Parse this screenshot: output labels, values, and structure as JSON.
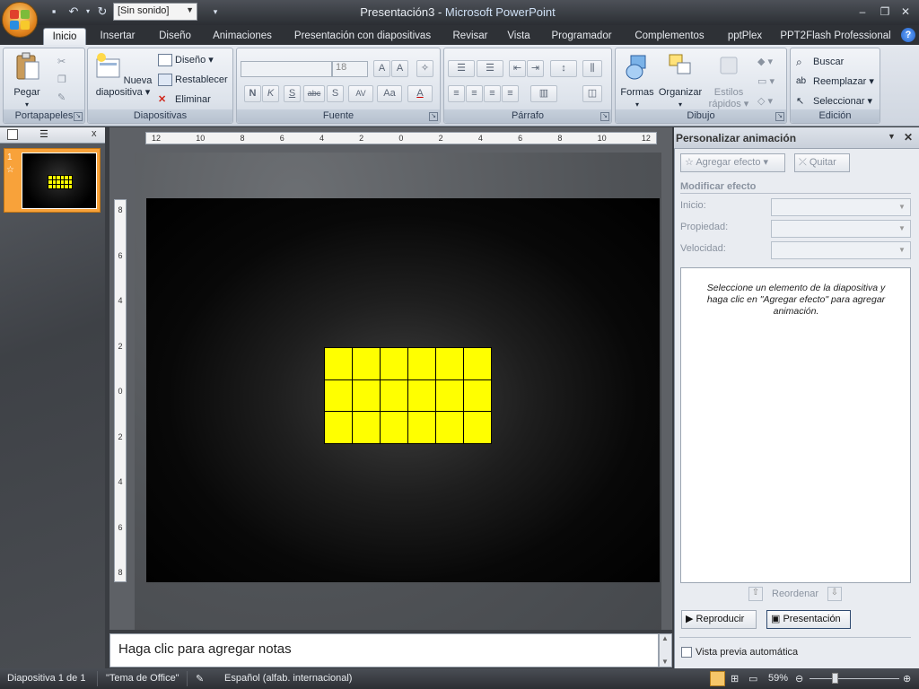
{
  "app": {
    "title": "Presentación3",
    "app_name": "Microsoft PowerPoint",
    "separator": " - "
  },
  "qat": {
    "sound_value": "[Sin sonido]"
  },
  "tabs": [
    "Inicio",
    "Insertar",
    "Diseño",
    "Animaciones",
    "Presentación con diapositivas",
    "Revisar",
    "Vista",
    "Programador",
    "Complementos",
    "pptPlex",
    "PPT2Flash Professional"
  ],
  "ribbon": {
    "portapapeles": {
      "label": "Portapapeles",
      "pegar": "Pegar"
    },
    "diapositivas": {
      "label": "Diapositivas",
      "nueva1": "Nueva",
      "nueva2": "diapositiva",
      "diseno": "Diseño",
      "restablecer": "Restablecer",
      "eliminar": "Eliminar"
    },
    "fuente": {
      "label": "Fuente",
      "size": "18",
      "bold": "N",
      "italic": "K",
      "underline": "S",
      "strike": "abc",
      "shadow": "S",
      "spacing": "AV",
      "case": "Aa",
      "color": "A"
    },
    "parrafo": {
      "label": "Párrafo"
    },
    "dibujo": {
      "label": "Dibujo",
      "formas": "Formas",
      "organizar": "Organizar",
      "estilos1": "Estilos",
      "estilos2": "rápidos"
    },
    "edicion": {
      "label": "Edición",
      "buscar": "Buscar",
      "reemplazar": "Reemplazar",
      "seleccionar": "Seleccionar"
    }
  },
  "thumbs": {
    "slide_number": "1",
    "close": "x"
  },
  "ruler": {
    "h": [
      "12",
      "10",
      "8",
      "6",
      "4",
      "2",
      "0",
      "2",
      "4",
      "6",
      "8",
      "10",
      "12"
    ],
    "v": [
      "8",
      "6",
      "4",
      "2",
      "0",
      "2",
      "4",
      "6",
      "8"
    ]
  },
  "slide": {
    "grid_rows": 3,
    "grid_cols": 6,
    "cell_color": "#ffff00"
  },
  "notes": {
    "placeholder": "Haga clic para agregar notas"
  },
  "taskpane": {
    "title": "Personalizar animación",
    "agregar": "Agregar efecto",
    "quitar": "Quitar",
    "modificar": "Modificar efecto",
    "inicio": "Inicio:",
    "propiedad": "Propiedad:",
    "velocidad": "Velocidad:",
    "hint": "Seleccione un elemento de la diapositiva y haga clic en \"Agregar efecto\" para agregar animación.",
    "reordenar": "Reordenar",
    "reproducir": "Reproducir",
    "presentacion": "Presentación",
    "vista_previa": "Vista previa automática"
  },
  "status": {
    "slide": "Diapositiva 1 de 1",
    "theme": "\"Tema de Office\"",
    "language": "Español (alfab. internacional)",
    "zoom": "59%"
  },
  "colors": {
    "accent_orange": "#f8a23a",
    "ribbon_blue": "#cfd6e0"
  }
}
